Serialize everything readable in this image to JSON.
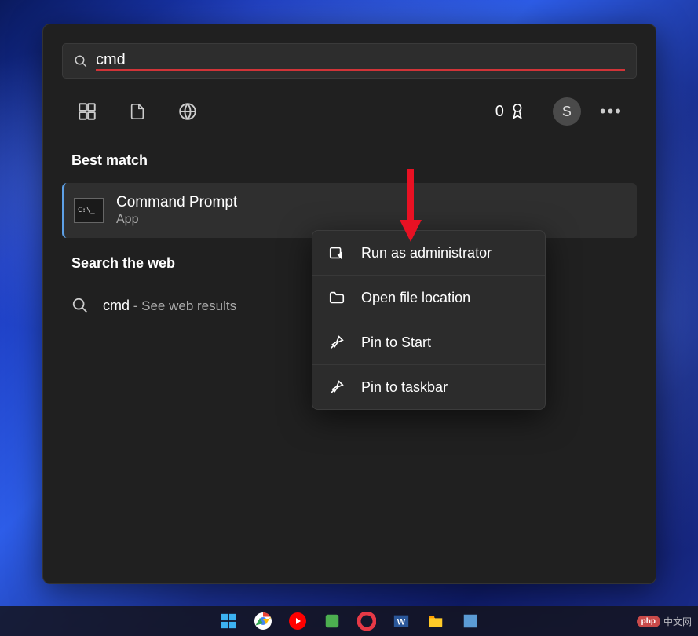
{
  "search": {
    "value": "cmd"
  },
  "header": {
    "rewards_count": "0",
    "avatar_initial": "S"
  },
  "sections": {
    "best_match_title": "Best match",
    "search_web_title": "Search the web"
  },
  "best_match": {
    "title": "Command Prompt",
    "subtitle": "App"
  },
  "web_result": {
    "term": "cmd",
    "suffix": " - See web results"
  },
  "context_menu": {
    "items": [
      {
        "label": "Run as administrator",
        "icon": "admin-shield-icon"
      },
      {
        "label": "Open file location",
        "icon": "folder-icon"
      },
      {
        "label": "Pin to Start",
        "icon": "pin-icon"
      },
      {
        "label": "Pin to taskbar",
        "icon": "pin-icon"
      }
    ]
  },
  "watermark": {
    "badge": "php",
    "text": "中文网"
  }
}
